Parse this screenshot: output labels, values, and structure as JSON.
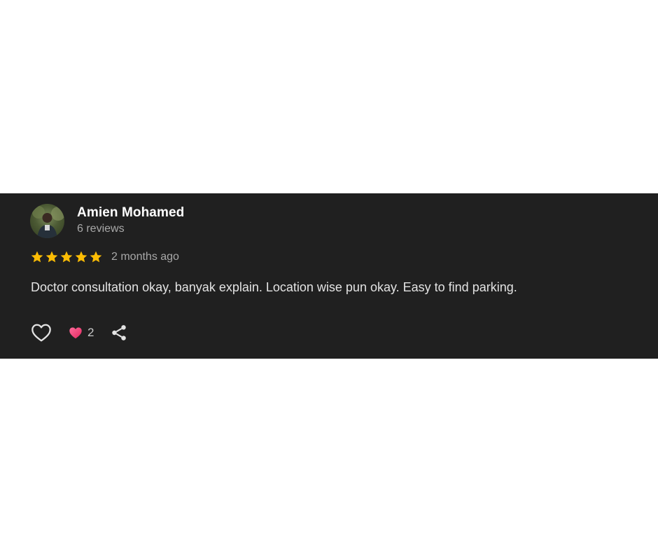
{
  "review": {
    "reviewer_name": "Amien Mohamed",
    "review_count": "6 reviews",
    "rating": 5,
    "rating_max": 5,
    "timestamp": "2 months ago",
    "text": "Doctor consultation okay, banyak explain. Location wise pun okay. Easy to find parking.",
    "reaction_count": "2"
  },
  "icons": {
    "avatar": "avatar",
    "star": "star-icon",
    "like": "heart-outline-icon",
    "reaction": "heart-filled-icon",
    "share": "share-icon"
  },
  "colors": {
    "card_background": "#202020",
    "star": "#fbbc04",
    "reaction_heart": "#e8356d",
    "name_text": "#ffffff",
    "secondary_text": "#a8a8a8",
    "body_text": "#e3e3e3"
  }
}
